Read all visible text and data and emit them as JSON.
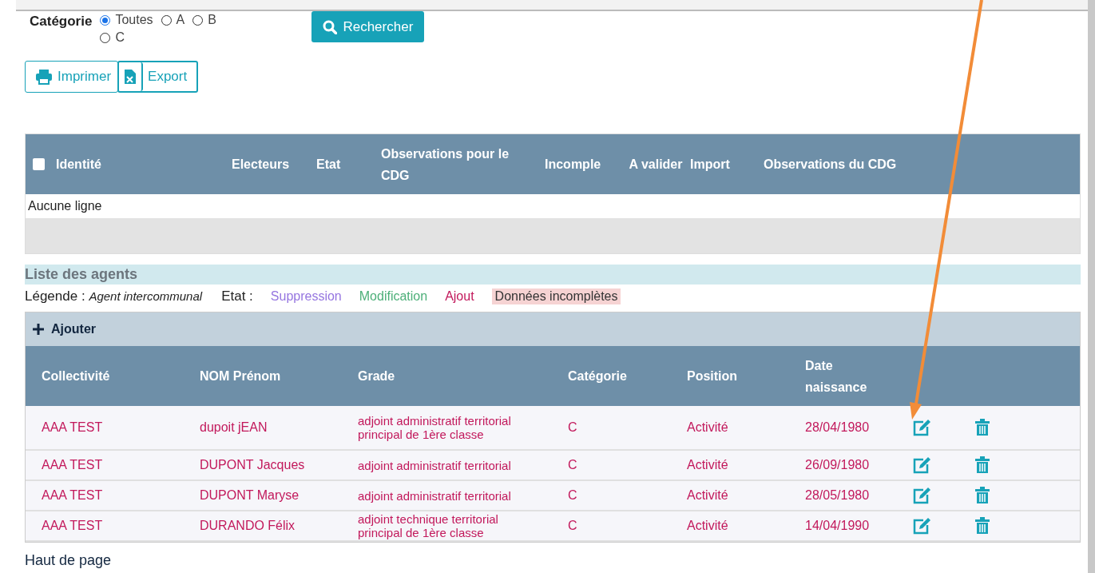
{
  "filter": {
    "label": "Catégorie",
    "options": [
      {
        "label": "Toutes",
        "selected": true
      },
      {
        "label": "A",
        "selected": false
      },
      {
        "label": "B",
        "selected": false
      },
      {
        "label": "C",
        "selected": false
      }
    ]
  },
  "search_button": "Rechercher",
  "actions": [
    {
      "label": "Imprimer",
      "kind": "print"
    },
    {
      "label": "Export",
      "kind": "export"
    }
  ],
  "import_table": {
    "select_all_checked": false,
    "columns": [
      "Identité",
      "Electeurs",
      "Etat",
      "Observations pour le CDG",
      "Incomple",
      "A valider",
      "Import",
      "Observations du CDG"
    ],
    "empty_message": "Aucune ligne"
  },
  "agents_section": {
    "title": "Liste des agents",
    "legend": {
      "label": "Légende :",
      "intercommunal": "Agent intercommunal",
      "state_label": "Etat :",
      "states": [
        {
          "label": "Suppression",
          "kind": "deleted"
        },
        {
          "label": "Modification",
          "kind": "modified"
        },
        {
          "label": "Ajout",
          "kind": "added"
        },
        {
          "label": "Données incomplètes",
          "kind": "incomplete"
        }
      ]
    }
  },
  "add_button": "Ajouter",
  "agents_table": {
    "columns": [
      "Collectivité",
      "NOM Prénom",
      "Grade",
      "Catégorie",
      "Position",
      "Date naissance"
    ],
    "rows": [
      {
        "cells": [
          "AAA TEST",
          "dupoit jEAN",
          "adjoint administratif territorial principal de 1ère classe",
          "C",
          "Activité",
          "28/04/1980"
        ]
      },
      {
        "cells": [
          "AAA TEST",
          "DUPONT Jacques",
          "adjoint administratif territorial",
          "C",
          "Activité",
          "26/09/1980"
        ]
      },
      {
        "cells": [
          "AAA TEST",
          "DUPONT Maryse",
          "adjoint administratif territorial",
          "C",
          "Activité",
          "28/05/1980"
        ]
      },
      {
        "cells": [
          "AAA TEST",
          "DURANDO Félix",
          "adjoint technique territorial principal de 1ère classe",
          "C",
          "Activité",
          "14/04/1990"
        ]
      }
    ]
  },
  "footer_link": "Haut de page"
}
